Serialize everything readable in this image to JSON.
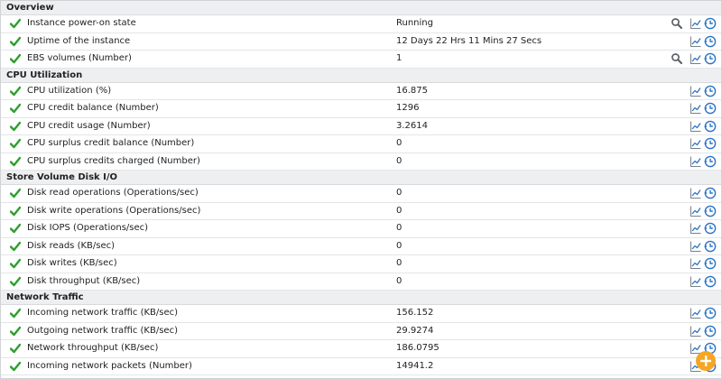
{
  "colors": {
    "status_ok": "#2e9e2e",
    "section_header_bg": "#eeeff0",
    "icon_blue": "#2c74c6",
    "add_button": "#f5a623"
  },
  "icons": {
    "status": "check-icon",
    "search": "magnifier-icon",
    "graph": "line-graph-icon",
    "history": "clock-history-icon",
    "add": "plus-icon"
  },
  "sections": [
    {
      "title": "Overview",
      "rows": [
        {
          "label": "Instance power-on state",
          "value": "Running",
          "search": true
        },
        {
          "label": "Uptime of the instance",
          "value": "12 Days 22 Hrs 11 Mins 27 Secs",
          "search": false
        },
        {
          "label": "EBS volumes (Number)",
          "value": "1",
          "search": true
        }
      ]
    },
    {
      "title": "CPU Utilization",
      "rows": [
        {
          "label": "CPU utilization (%)",
          "value": "16.875",
          "search": false
        },
        {
          "label": "CPU credit balance (Number)",
          "value": "1296",
          "search": false
        },
        {
          "label": "CPU credit usage (Number)",
          "value": "3.2614",
          "search": false
        },
        {
          "label": "CPU surplus credit balance (Number)",
          "value": "0",
          "search": false
        },
        {
          "label": "CPU surplus credits charged (Number)",
          "value": "0",
          "search": false
        }
      ]
    },
    {
      "title": "Store Volume Disk I/O",
      "rows": [
        {
          "label": "Disk read operations (Operations/sec)",
          "value": "0",
          "search": false
        },
        {
          "label": "Disk write operations (Operations/sec)",
          "value": "0",
          "search": false
        },
        {
          "label": "Disk IOPS (Operations/sec)",
          "value": "0",
          "search": false
        },
        {
          "label": "Disk reads (KB/sec)",
          "value": "0",
          "search": false
        },
        {
          "label": "Disk writes (KB/sec)",
          "value": "0",
          "search": false
        },
        {
          "label": "Disk throughput (KB/sec)",
          "value": "0",
          "search": false
        }
      ]
    },
    {
      "title": "Network Traffic",
      "rows": [
        {
          "label": "Incoming network traffic (KB/sec)",
          "value": "156.152",
          "search": false
        },
        {
          "label": "Outgoing network traffic (KB/sec)",
          "value": "29.9274",
          "search": false
        },
        {
          "label": "Network throughput (KB/sec)",
          "value": "186.0795",
          "search": false
        },
        {
          "label": "Incoming network packets (Number)",
          "value": "14941.2",
          "search": false
        }
      ]
    }
  ]
}
